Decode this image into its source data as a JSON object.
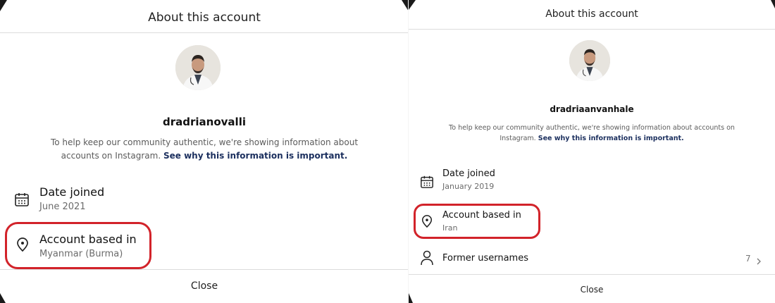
{
  "left": {
    "title": "About this account",
    "username": "dradrianovalli",
    "description": "To help keep our community authentic, we're showing information about accounts on Instagram.",
    "link_text": "See why this information is important.",
    "date_joined_label": "Date joined",
    "date_joined_value": "June 2021",
    "based_in_label": "Account based in",
    "based_in_value": "Myanmar (Burma)",
    "close_label": "Close"
  },
  "right": {
    "title": "About this account",
    "username": "dradriaanvanhale",
    "description": "To help keep our community authentic, we're showing information about accounts on Instagram.",
    "link_text": "See why this information is important.",
    "date_joined_label": "Date joined",
    "date_joined_value": "January 2019",
    "based_in_label": "Account based in",
    "based_in_value": "Iran",
    "former_usernames_label": "Former usernames",
    "former_usernames_count": "7",
    "close_label": "Close"
  },
  "colors": {
    "highlight": "#d2232a",
    "link": "#1b2f5e"
  },
  "icons": [
    "calendar-icon",
    "location-pin-icon",
    "person-icon",
    "chevron-right-icon"
  ]
}
